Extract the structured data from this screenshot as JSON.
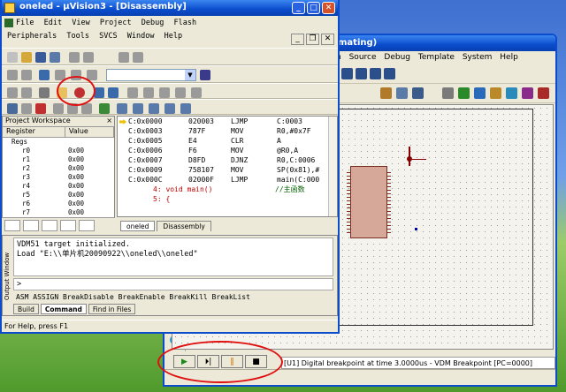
{
  "uvision": {
    "title": "oneled - µVision3 - [Disassembly]",
    "menu_row1": [
      "File",
      "Edit",
      "View",
      "Project",
      "Debug",
      "Flash"
    ],
    "menu_row2": [
      "Peripherals",
      "Tools",
      "SVCS",
      "Window",
      "Help"
    ],
    "workspace": {
      "title": "Project Workspace",
      "col_register": "Register",
      "col_value": "Value",
      "group": "Regs",
      "registers": [
        {
          "name": "r0",
          "value": "0x00"
        },
        {
          "name": "r1",
          "value": "0x00"
        },
        {
          "name": "r2",
          "value": "0x00"
        },
        {
          "name": "r3",
          "value": "0x00"
        },
        {
          "name": "r4",
          "value": "0x00"
        },
        {
          "name": "r5",
          "value": "0x00"
        },
        {
          "name": "r6",
          "value": "0x00"
        },
        {
          "name": "r7",
          "value": "0x00"
        }
      ]
    },
    "disassembly": [
      {
        "addr": "C:0x0000",
        "code": "020003",
        "mnem": "LJMP",
        "ops": "C:0003"
      },
      {
        "addr": "C:0x0003",
        "code": "787F",
        "mnem": "MOV",
        "ops": "R0,#0x7F"
      },
      {
        "addr": "C:0x0005",
        "code": "E4",
        "mnem": "CLR",
        "ops": "A"
      },
      {
        "addr": "C:0x0006",
        "code": "F6",
        "mnem": "MOV",
        "ops": "@R0,A"
      },
      {
        "addr": "C:0x0007",
        "code": "D8FD",
        "mnem": "DJNZ",
        "ops": "R0,C:0006"
      },
      {
        "addr": "C:0x0009",
        "code": "758107",
        "mnem": "MOV",
        "ops": "SP(0x81),#"
      },
      {
        "addr": "C:0x000C",
        "code": "02000F",
        "mnem": "LJMP",
        "ops": "main(C:000"
      }
    ],
    "source_lines": [
      {
        "text": "4: void main()",
        "comment": "//主函数"
      },
      {
        "text": "5: {",
        "comment": ""
      }
    ],
    "doc_tabs": [
      "oneled",
      "Disassembly"
    ],
    "output": {
      "side_label": "Output Window",
      "lines": [
        "VDM51 target initialized.",
        "Load \"E:\\\\单片机20090922\\\\oneled\\\\oneled\""
      ],
      "prompt": ">",
      "hints": "ASM ASSIGN BreakDisable BreakEnable BreakKill BreakList",
      "tabs": [
        "Build",
        "Command",
        "Find in Files"
      ]
    },
    "status": "For Help, press F1"
  },
  "isis": {
    "title_suffix": "mating)",
    "menu": [
      "h",
      "Source",
      "Debug",
      "Template",
      "System",
      "Help"
    ],
    "status_message": "[U1] Digital breakpoint at time 3.0000us - VDM Breakpoint [PC=0000]",
    "sim_buttons": [
      "play",
      "step",
      "pause",
      "stop"
    ]
  },
  "colors": {
    "titlebar": "#0a4ccc",
    "highlight_circle": "#e01010",
    "source_line": "#c00000",
    "comment": "#006000"
  }
}
